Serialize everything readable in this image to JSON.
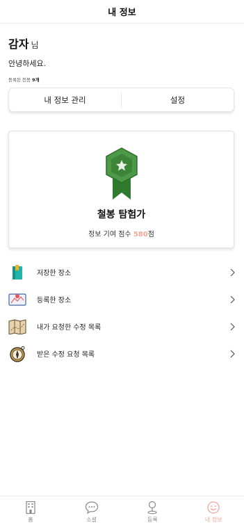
{
  "header": {
    "title": "내 정보"
  },
  "profile": {
    "name": "감자",
    "suffix": "님",
    "greeting": "안녕하세요.",
    "registered_label": "등록된 천봉",
    "registered_count": "9개"
  },
  "actions": {
    "manage_label": "내 정보 관리",
    "settings_label": "설정"
  },
  "badge": {
    "title": "철봉 탐험가",
    "score_prefix": "정보 기여 점수",
    "score_value": "580",
    "score_suffix": "점",
    "colors": {
      "badge": "#3f8f3c",
      "score": "#f2a79d"
    }
  },
  "menu": {
    "items": [
      {
        "label": "저장한 장소",
        "icon": "bookmark-icon"
      },
      {
        "label": "등록한 장소",
        "icon": "map-pin-icon"
      },
      {
        "label": "내가 요청한 수정 목록",
        "icon": "folded-map-icon"
      },
      {
        "label": "받은 수정 요청 목록",
        "icon": "compass-icon"
      }
    ]
  },
  "bottom_nav": {
    "items": [
      {
        "label": "홈",
        "icon": "building-icon"
      },
      {
        "label": "소셜",
        "icon": "chat-bubble-icon"
      },
      {
        "label": "등록",
        "icon": "location-pin-icon"
      },
      {
        "label": "내 정보",
        "icon": "smiley-icon",
        "active": true
      }
    ]
  }
}
